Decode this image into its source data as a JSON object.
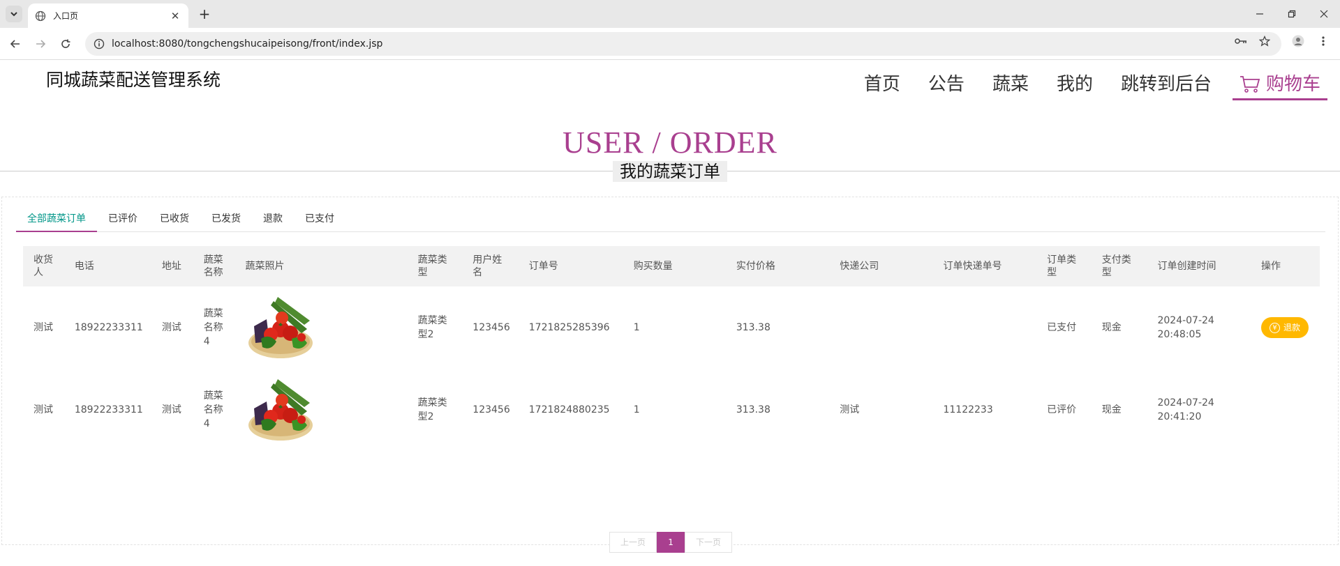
{
  "browser": {
    "tab_title": "入口页",
    "url": "localhost:8080/tongchengshucaipeisong/front/index.jsp"
  },
  "header": {
    "brand": "同城蔬菜配送管理系统",
    "nav": [
      "首页",
      "公告",
      "蔬菜",
      "我的",
      "跳转到后台"
    ],
    "cart_label": "购物车"
  },
  "title": {
    "en": "USER / ORDER",
    "zh": "我的蔬菜订单"
  },
  "tabs": [
    "全部蔬菜订单",
    "已评价",
    "已收货",
    "已发货",
    "退款",
    "已支付"
  ],
  "table": {
    "headers": [
      "收货人",
      "电话",
      "地址",
      "蔬菜名称",
      "蔬菜照片",
      "蔬菜类型",
      "用户姓名",
      "订单号",
      "购买数量",
      "实付价格",
      "快递公司",
      "订单快递单号",
      "订单类型",
      "支付类型",
      "订单创建时间",
      "操作"
    ],
    "rows": [
      {
        "receiver": "测试",
        "phone": "18922233311",
        "address": "测试",
        "name": "蔬菜名称4",
        "type": "蔬菜类型2",
        "username": "123456",
        "order_no": "1721825285396",
        "qty": "1",
        "price": "313.38",
        "express": "",
        "tracking": "",
        "status": "已支付",
        "pay_type": "现金",
        "created_date": "2024-07-24",
        "created_time": "20:48:05",
        "action": "退款"
      },
      {
        "receiver": "测试",
        "phone": "18922233311",
        "address": "测试",
        "name": "蔬菜名称4",
        "type": "蔬菜类型2",
        "username": "123456",
        "order_no": "1721824880235",
        "qty": "1",
        "price": "313.38",
        "express": "测试",
        "tracking": "11122233",
        "status": "已评价",
        "pay_type": "现金",
        "created_date": "2024-07-24",
        "created_time": "20:41:20",
        "action": ""
      }
    ]
  },
  "pager": {
    "prev": "上一页",
    "current": "1",
    "next": "下一页"
  },
  "colors": {
    "accent": "#a93f8f",
    "active_tab": "#009688",
    "refund_button": "#ffb800"
  }
}
